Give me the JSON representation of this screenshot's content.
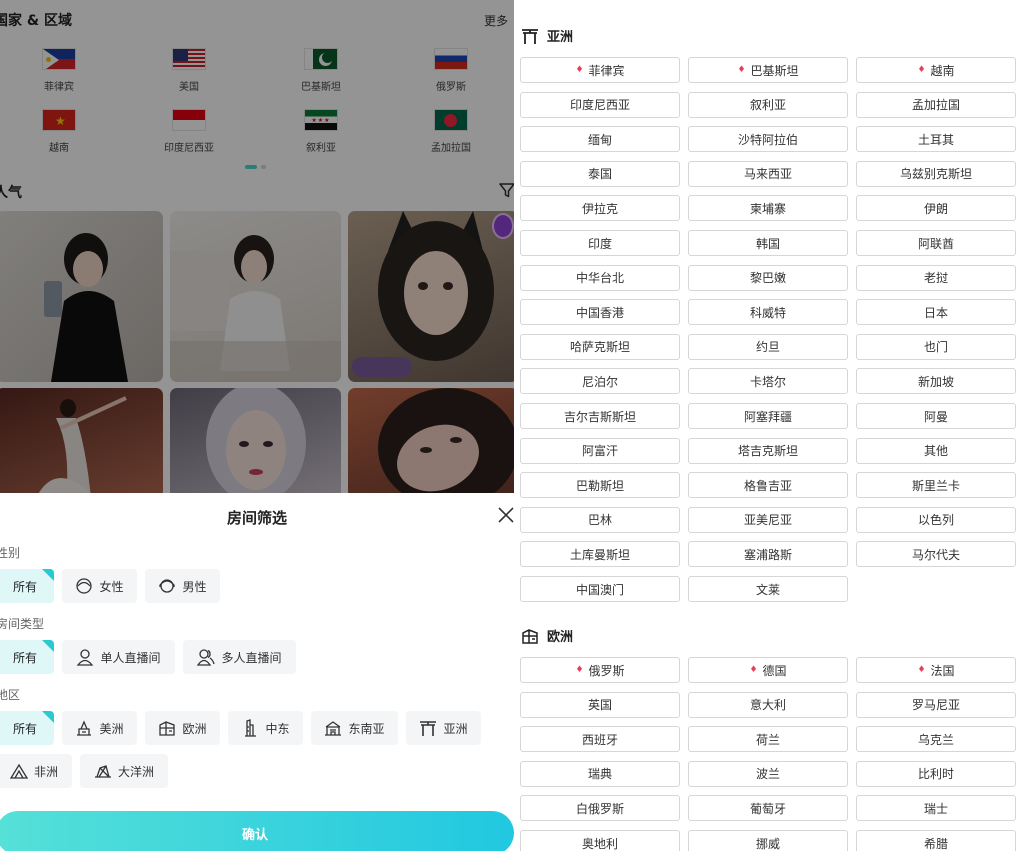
{
  "countries_section": {
    "title": "国家 & 区域",
    "more": "更多",
    "flags": [
      {
        "name": "菲律宾",
        "code": "ph"
      },
      {
        "name": "美国",
        "code": "us"
      },
      {
        "name": "巴基斯坦",
        "code": "pk"
      },
      {
        "name": "俄罗斯",
        "code": "ru"
      },
      {
        "name": "越南",
        "code": "vn"
      },
      {
        "name": "印度尼西亚",
        "code": "id"
      },
      {
        "name": "叙利亚",
        "code": "sy"
      },
      {
        "name": "孟加拉国",
        "code": "bd"
      }
    ]
  },
  "popular": {
    "title": "人气",
    "filter_icon": "funnel-icon"
  },
  "sheet": {
    "title": "房间筛选",
    "close_icon": "close-icon",
    "gender": {
      "label": "性别",
      "options": [
        {
          "label": "所有",
          "selected": true,
          "icon": ""
        },
        {
          "label": "女性",
          "selected": false,
          "icon": "female-avatar-icon"
        },
        {
          "label": "男性",
          "selected": false,
          "icon": "male-avatar-icon"
        }
      ]
    },
    "room_type": {
      "label": "房间类型",
      "options": [
        {
          "label": "所有",
          "selected": true,
          "icon": ""
        },
        {
          "label": "单人直播间",
          "selected": false,
          "icon": "single-user-icon"
        },
        {
          "label": "多人直播间",
          "selected": false,
          "icon": "multi-user-icon"
        }
      ]
    },
    "region": {
      "label": "地区",
      "options": [
        {
          "label": "所有",
          "selected": true,
          "icon": ""
        },
        {
          "label": "美洲",
          "selected": false,
          "icon": "americas-icon"
        },
        {
          "label": "欧洲",
          "selected": false,
          "icon": "europe-icon"
        },
        {
          "label": "中东",
          "selected": false,
          "icon": "middle-east-icon"
        },
        {
          "label": "东南亚",
          "selected": false,
          "icon": "southeast-asia-icon"
        },
        {
          "label": "亚洲",
          "selected": false,
          "icon": "asia-icon"
        },
        {
          "label": "非洲",
          "selected": false,
          "icon": "africa-icon"
        },
        {
          "label": "大洋洲",
          "selected": false,
          "icon": "oceania-icon"
        }
      ]
    },
    "confirm": "确认"
  },
  "continents": {
    "asia": {
      "title": "亚洲",
      "icon": "torii-gate-icon",
      "countries": [
        {
          "name": "菲律宾",
          "hot": true
        },
        {
          "name": "巴基斯坦",
          "hot": true
        },
        {
          "name": "越南",
          "hot": true
        },
        {
          "name": "印度尼西亚"
        },
        {
          "name": "叙利亚"
        },
        {
          "name": "孟加拉国"
        },
        {
          "name": "缅甸"
        },
        {
          "name": "沙特阿拉伯"
        },
        {
          "name": "土耳其"
        },
        {
          "name": "泰国"
        },
        {
          "name": "马来西亚"
        },
        {
          "name": "乌兹别克斯坦"
        },
        {
          "name": "伊拉克"
        },
        {
          "name": "柬埔寨"
        },
        {
          "name": "伊朗"
        },
        {
          "name": "印度"
        },
        {
          "name": "韩国"
        },
        {
          "name": "阿联酋"
        },
        {
          "name": "中华台北"
        },
        {
          "name": "黎巴嫩"
        },
        {
          "name": "老挝"
        },
        {
          "name": "中国香港"
        },
        {
          "name": "科威特"
        },
        {
          "name": "日本"
        },
        {
          "name": "哈萨克斯坦"
        },
        {
          "name": "约旦"
        },
        {
          "name": "也门"
        },
        {
          "name": "尼泊尔"
        },
        {
          "name": "卡塔尔"
        },
        {
          "name": "新加坡"
        },
        {
          "name": "吉尔吉斯斯坦"
        },
        {
          "name": "阿塞拜疆"
        },
        {
          "name": "阿曼"
        },
        {
          "name": "阿富汗"
        },
        {
          "name": "塔吉克斯坦"
        },
        {
          "name": "其他"
        },
        {
          "name": "巴勒斯坦"
        },
        {
          "name": "格鲁吉亚"
        },
        {
          "name": "斯里兰卡"
        },
        {
          "name": "巴林"
        },
        {
          "name": "亚美尼亚"
        },
        {
          "name": "以色列"
        },
        {
          "name": "土库曼斯坦"
        },
        {
          "name": "塞浦路斯"
        },
        {
          "name": "马尔代夫"
        },
        {
          "name": "中国澳门"
        },
        {
          "name": "文莱"
        }
      ]
    },
    "europe": {
      "title": "欧洲",
      "icon": "europe-building-icon",
      "countries": [
        {
          "name": "俄罗斯",
          "hot": true
        },
        {
          "name": "德国",
          "hot": true
        },
        {
          "name": "法国",
          "hot": true
        },
        {
          "name": "英国"
        },
        {
          "name": "意大利"
        },
        {
          "name": "罗马尼亚"
        },
        {
          "name": "西班牙"
        },
        {
          "name": "荷兰"
        },
        {
          "name": "乌克兰"
        },
        {
          "name": "瑞典"
        },
        {
          "name": "波兰"
        },
        {
          "name": "比利时"
        },
        {
          "name": "白俄罗斯"
        },
        {
          "name": "葡萄牙"
        },
        {
          "name": "瑞士"
        },
        {
          "name": "奥地利"
        },
        {
          "name": "挪威"
        },
        {
          "name": "希腊"
        }
      ]
    }
  },
  "hot_marker": "♦"
}
